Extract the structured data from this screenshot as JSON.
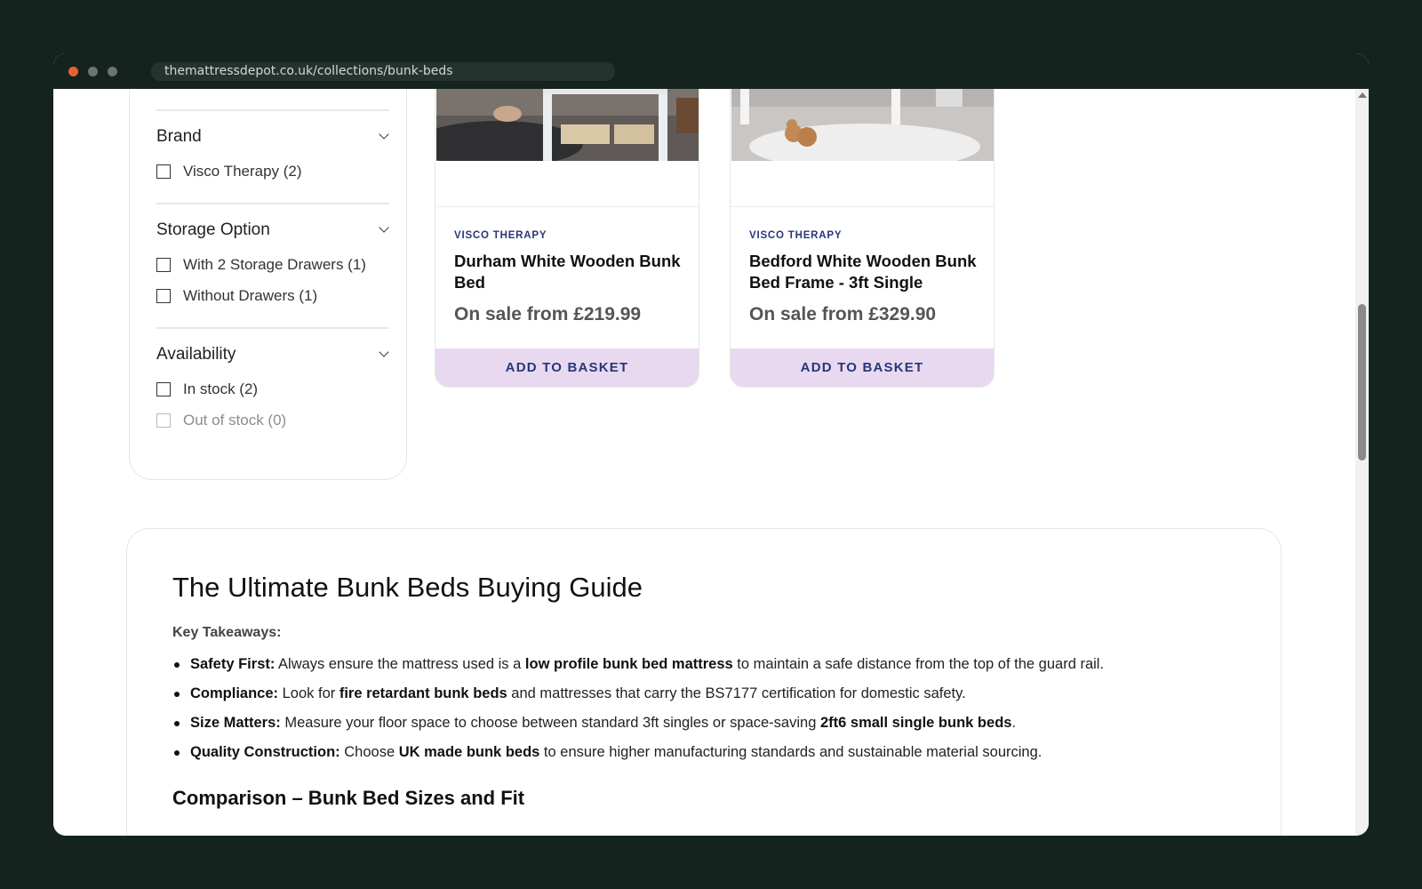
{
  "browser": {
    "url": "themattressdepot.co.uk/collections/bunk-beds"
  },
  "filters": [
    {
      "title": "Brand",
      "options": [
        {
          "label": "Visco Therapy (2)",
          "disabled": false
        }
      ]
    },
    {
      "title": "Storage Option",
      "options": [
        {
          "label": "With 2 Storage Drawers (1)",
          "disabled": false
        },
        {
          "label": "Without Drawers (1)",
          "disabled": false
        }
      ]
    },
    {
      "title": "Availability",
      "options": [
        {
          "label": "In stock (2)",
          "disabled": false
        },
        {
          "label": "Out of stock (0)",
          "disabled": true
        }
      ]
    }
  ],
  "products": [
    {
      "brand": "VISCO THERAPY",
      "title": "Durham White Wooden Bunk Bed",
      "price": "On sale from £219.99",
      "button": "ADD TO BASKET"
    },
    {
      "brand": "VISCO THERAPY",
      "title": "Bedford White Wooden Bunk Bed Frame - 3ft Single",
      "price": "On sale from £329.90",
      "button": "ADD TO BASKET"
    }
  ],
  "guide": {
    "title": "The Ultimate Bunk Beds Buying Guide",
    "takeaways_label": "Key Takeaways:",
    "bullets": [
      {
        "lead": "Safety First:",
        "t1": " Always ensure the mattress used is a ",
        "b1": "low profile bunk bed mattress",
        "t2": " to maintain a safe distance from the top of the guard rail.",
        "b2": "",
        "t3": ""
      },
      {
        "lead": "Compliance:",
        "t1": " Look for ",
        "b1": "fire retardant bunk beds",
        "t2": " and mattresses that carry the BS7177 certification for domestic safety.",
        "b2": "",
        "t3": ""
      },
      {
        "lead": "Size Matters:",
        "t1": " Measure your floor space to choose between standard 3ft singles or space-saving ",
        "b1": "2ft6 small single bunk beds",
        "t2": ".",
        "b2": "",
        "t3": ""
      },
      {
        "lead": "Quality Construction:",
        "t1": " Choose ",
        "b1": "UK made bunk beds",
        "t2": " to ensure higher manufacturing standards and sustainable material sourcing.",
        "b2": "",
        "t3": ""
      }
    ],
    "subheading": "Comparison – Bunk Bed Sizes and Fit"
  }
}
